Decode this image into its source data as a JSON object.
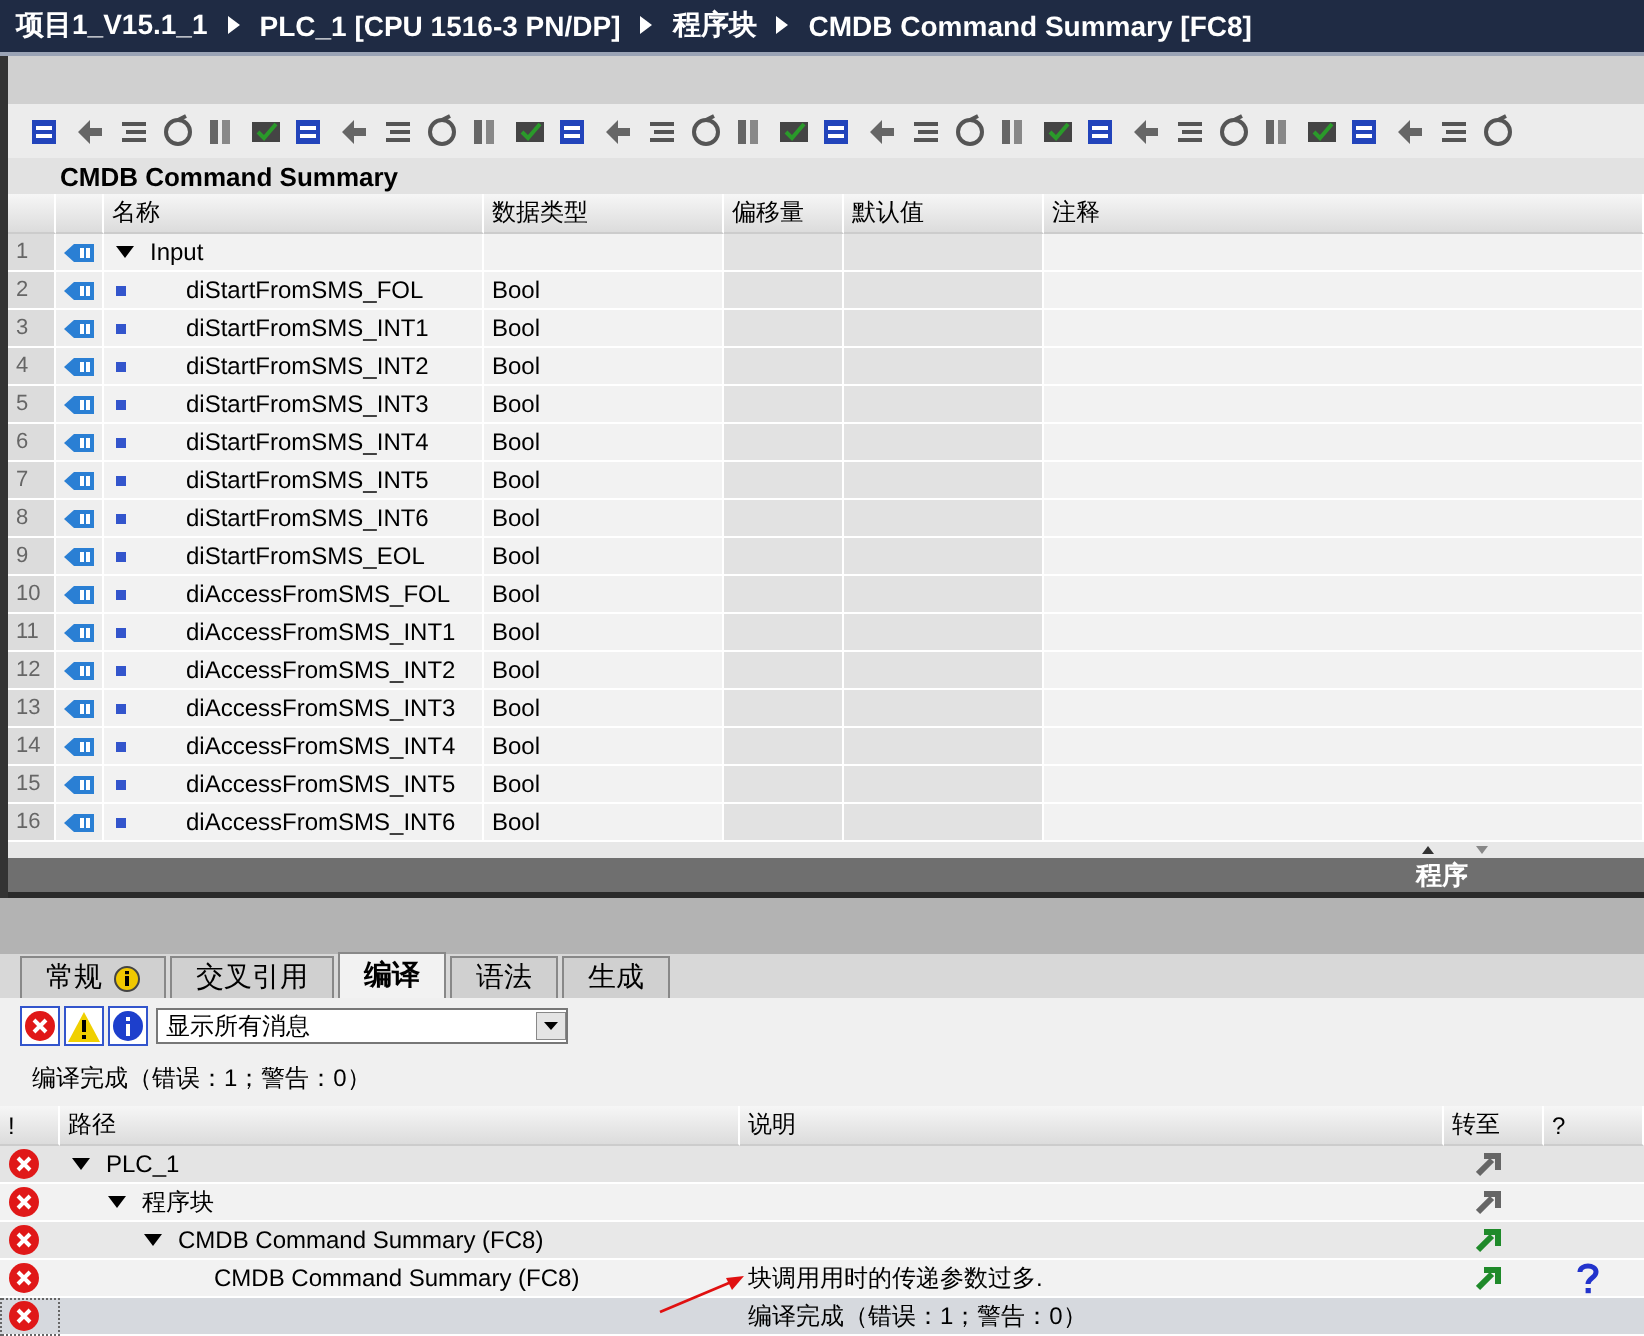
{
  "breadcrumb": [
    "项目1_V15.1_1",
    "PLC_1 [CPU 1516-3 PN/DP]",
    "程序块",
    "CMDB Command Summary [FC8]"
  ],
  "block_title": "CMDB Command Summary",
  "table": {
    "columns": [
      "名称",
      "数据类型",
      "偏移量",
      "默认值",
      "注释"
    ],
    "rows": [
      {
        "number": "1",
        "name": "Input",
        "type": "",
        "expanded": true,
        "children": [
          {
            "number": "2",
            "name": "diStartFromSMS_FOL",
            "type": "Bool"
          },
          {
            "number": "3",
            "name": "diStartFromSMS_INT1",
            "type": "Bool"
          },
          {
            "number": "4",
            "name": "diStartFromSMS_INT2",
            "type": "Bool"
          },
          {
            "number": "5",
            "name": "diStartFromSMS_INT3",
            "type": "Bool"
          },
          {
            "number": "6",
            "name": "diStartFromSMS_INT4",
            "type": "Bool"
          },
          {
            "number": "7",
            "name": "diStartFromSMS_INT5",
            "type": "Bool"
          },
          {
            "number": "8",
            "name": "diStartFromSMS_INT6",
            "type": "Bool"
          },
          {
            "number": "9",
            "name": "diStartFromSMS_EOL",
            "type": "Bool"
          },
          {
            "number": "10",
            "name": "diAccessFromSMS_FOL",
            "type": "Bool"
          },
          {
            "number": "11",
            "name": "diAccessFromSMS_INT1",
            "type": "Bool"
          },
          {
            "number": "12",
            "name": "diAccessFromSMS_INT2",
            "type": "Bool"
          },
          {
            "number": "13",
            "name": "diAccessFromSMS_INT3",
            "type": "Bool"
          },
          {
            "number": "14",
            "name": "diAccessFromSMS_INT4",
            "type": "Bool"
          },
          {
            "number": "15",
            "name": "diAccessFromSMS_INT5",
            "type": "Bool"
          },
          {
            "number": "16",
            "name": "diAccessFromSMS_INT6",
            "type": "Bool"
          }
        ]
      }
    ]
  },
  "editor_footer": "程序",
  "tabs": [
    {
      "label": "常规",
      "selected": false,
      "info": true
    },
    {
      "label": "交叉引用",
      "selected": false,
      "info": false
    },
    {
      "label": "编译",
      "selected": true,
      "info": false
    },
    {
      "label": "语法",
      "selected": false,
      "info": false
    },
    {
      "label": "生成",
      "selected": false,
      "info": false
    }
  ],
  "filter": {
    "value": "显示所有消息"
  },
  "status": "编译完成（错误：1；警告：0）",
  "messages": {
    "columns": [
      "!",
      "路径",
      "说明",
      "转至",
      "?"
    ],
    "rows": [
      {
        "path": "PLC_1",
        "expanded": true,
        "goto_active": false,
        "children": [
          {
            "path": "程序块",
            "expanded": true,
            "goto_active": false,
            "children": [
              {
                "path": "CMDB Command Summary (FC8)",
                "expanded": true,
                "goto_active": true,
                "children": [
                  {
                    "path": "CMDB Command Summary (FC8)",
                    "description": "块调用用时的传递参数过多.",
                    "goto_active": true,
                    "help": true
                  }
                ]
              }
            ]
          }
        ]
      }
    ],
    "summary": {
      "description": "编译完成（错误：1；警告：0）",
      "selected": true
    }
  }
}
